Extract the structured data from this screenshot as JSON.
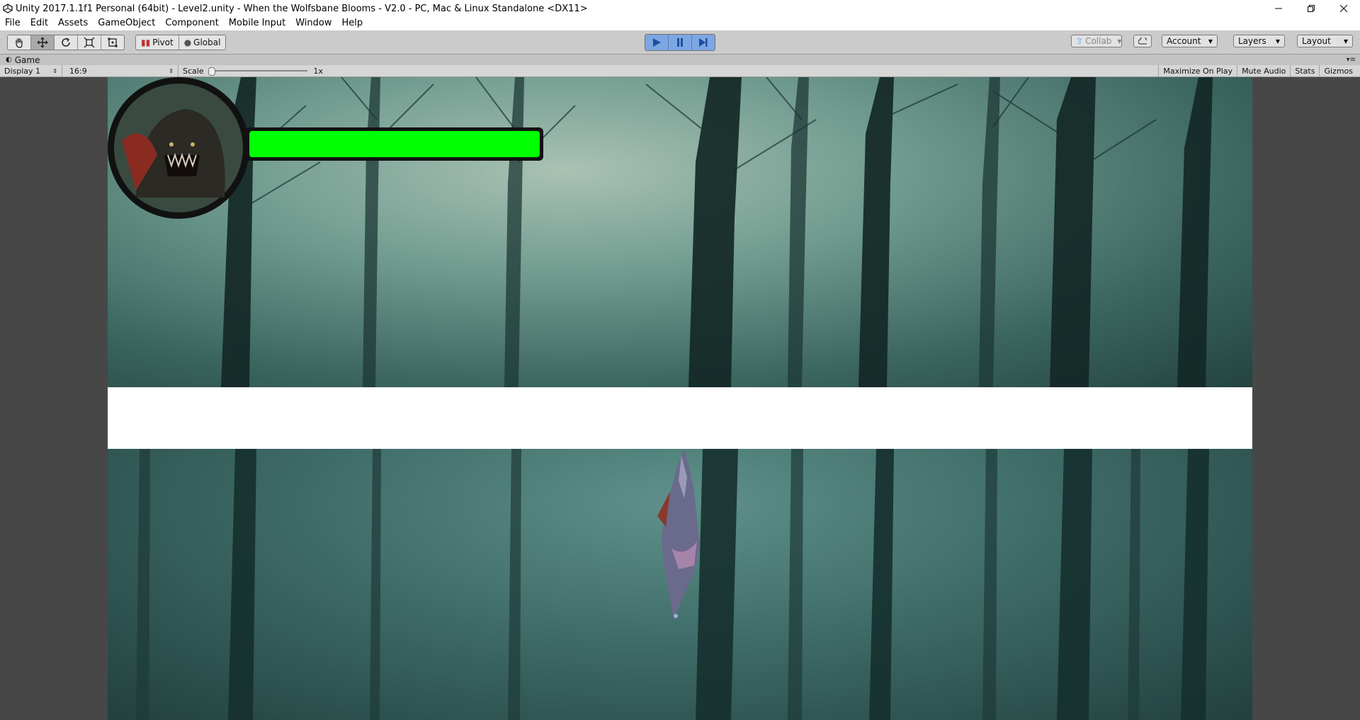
{
  "window": {
    "title": "Unity 2017.1.1f1 Personal (64bit) - Level2.unity - When the Wolfsbane Blooms - V2.0 - PC, Mac & Linux Standalone <DX11>"
  },
  "menu": [
    "File",
    "Edit",
    "Assets",
    "GameObject",
    "Component",
    "Mobile Input",
    "Window",
    "Help"
  ],
  "toolbar": {
    "pivot_label": "Pivot",
    "global_label": "Global",
    "collab_label": "Collab",
    "account_label": "Account",
    "layers_label": "Layers",
    "layout_label": "Layout"
  },
  "game_tab": {
    "label": "Game",
    "display": "Display 1",
    "aspect": "16:9",
    "scale_label": "Scale",
    "scale_value": "1x",
    "maximize_label": "Maximize On Play",
    "mute_label": "Mute Audio",
    "stats_label": "Stats",
    "gizmos_label": "Gizmos"
  },
  "game": {
    "health_fraction": 1.0,
    "colors": {
      "health": "#00ff00",
      "play_active": "#7da7e3"
    }
  }
}
